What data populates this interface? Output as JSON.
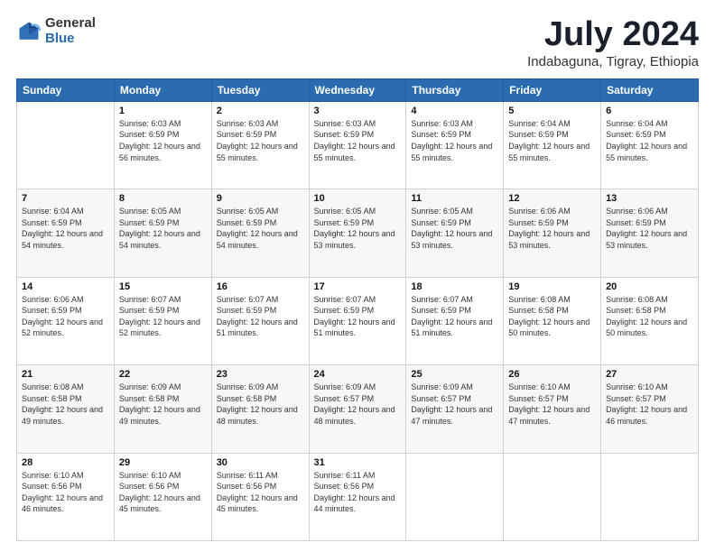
{
  "header": {
    "logo_general": "General",
    "logo_blue": "Blue",
    "month_title": "July 2024",
    "subtitle": "Indabaguna, Tigray, Ethiopia"
  },
  "weekdays": [
    "Sunday",
    "Monday",
    "Tuesday",
    "Wednesday",
    "Thursday",
    "Friday",
    "Saturday"
  ],
  "weeks": [
    [
      {
        "day": "",
        "sunrise": "",
        "sunset": "",
        "daylight": ""
      },
      {
        "day": "1",
        "sunrise": "Sunrise: 6:03 AM",
        "sunset": "Sunset: 6:59 PM",
        "daylight": "Daylight: 12 hours and 56 minutes."
      },
      {
        "day": "2",
        "sunrise": "Sunrise: 6:03 AM",
        "sunset": "Sunset: 6:59 PM",
        "daylight": "Daylight: 12 hours and 55 minutes."
      },
      {
        "day": "3",
        "sunrise": "Sunrise: 6:03 AM",
        "sunset": "Sunset: 6:59 PM",
        "daylight": "Daylight: 12 hours and 55 minutes."
      },
      {
        "day": "4",
        "sunrise": "Sunrise: 6:03 AM",
        "sunset": "Sunset: 6:59 PM",
        "daylight": "Daylight: 12 hours and 55 minutes."
      },
      {
        "day": "5",
        "sunrise": "Sunrise: 6:04 AM",
        "sunset": "Sunset: 6:59 PM",
        "daylight": "Daylight: 12 hours and 55 minutes."
      },
      {
        "day": "6",
        "sunrise": "Sunrise: 6:04 AM",
        "sunset": "Sunset: 6:59 PM",
        "daylight": "Daylight: 12 hours and 55 minutes."
      }
    ],
    [
      {
        "day": "7",
        "sunrise": "Sunrise: 6:04 AM",
        "sunset": "Sunset: 6:59 PM",
        "daylight": "Daylight: 12 hours and 54 minutes."
      },
      {
        "day": "8",
        "sunrise": "Sunrise: 6:05 AM",
        "sunset": "Sunset: 6:59 PM",
        "daylight": "Daylight: 12 hours and 54 minutes."
      },
      {
        "day": "9",
        "sunrise": "Sunrise: 6:05 AM",
        "sunset": "Sunset: 6:59 PM",
        "daylight": "Daylight: 12 hours and 54 minutes."
      },
      {
        "day": "10",
        "sunrise": "Sunrise: 6:05 AM",
        "sunset": "Sunset: 6:59 PM",
        "daylight": "Daylight: 12 hours and 53 minutes."
      },
      {
        "day": "11",
        "sunrise": "Sunrise: 6:05 AM",
        "sunset": "Sunset: 6:59 PM",
        "daylight": "Daylight: 12 hours and 53 minutes."
      },
      {
        "day": "12",
        "sunrise": "Sunrise: 6:06 AM",
        "sunset": "Sunset: 6:59 PM",
        "daylight": "Daylight: 12 hours and 53 minutes."
      },
      {
        "day": "13",
        "sunrise": "Sunrise: 6:06 AM",
        "sunset": "Sunset: 6:59 PM",
        "daylight": "Daylight: 12 hours and 53 minutes."
      }
    ],
    [
      {
        "day": "14",
        "sunrise": "Sunrise: 6:06 AM",
        "sunset": "Sunset: 6:59 PM",
        "daylight": "Daylight: 12 hours and 52 minutes."
      },
      {
        "day": "15",
        "sunrise": "Sunrise: 6:07 AM",
        "sunset": "Sunset: 6:59 PM",
        "daylight": "Daylight: 12 hours and 52 minutes."
      },
      {
        "day": "16",
        "sunrise": "Sunrise: 6:07 AM",
        "sunset": "Sunset: 6:59 PM",
        "daylight": "Daylight: 12 hours and 51 minutes."
      },
      {
        "day": "17",
        "sunrise": "Sunrise: 6:07 AM",
        "sunset": "Sunset: 6:59 PM",
        "daylight": "Daylight: 12 hours and 51 minutes."
      },
      {
        "day": "18",
        "sunrise": "Sunrise: 6:07 AM",
        "sunset": "Sunset: 6:59 PM",
        "daylight": "Daylight: 12 hours and 51 minutes."
      },
      {
        "day": "19",
        "sunrise": "Sunrise: 6:08 AM",
        "sunset": "Sunset: 6:58 PM",
        "daylight": "Daylight: 12 hours and 50 minutes."
      },
      {
        "day": "20",
        "sunrise": "Sunrise: 6:08 AM",
        "sunset": "Sunset: 6:58 PM",
        "daylight": "Daylight: 12 hours and 50 minutes."
      }
    ],
    [
      {
        "day": "21",
        "sunrise": "Sunrise: 6:08 AM",
        "sunset": "Sunset: 6:58 PM",
        "daylight": "Daylight: 12 hours and 49 minutes."
      },
      {
        "day": "22",
        "sunrise": "Sunrise: 6:09 AM",
        "sunset": "Sunset: 6:58 PM",
        "daylight": "Daylight: 12 hours and 49 minutes."
      },
      {
        "day": "23",
        "sunrise": "Sunrise: 6:09 AM",
        "sunset": "Sunset: 6:58 PM",
        "daylight": "Daylight: 12 hours and 48 minutes."
      },
      {
        "day": "24",
        "sunrise": "Sunrise: 6:09 AM",
        "sunset": "Sunset: 6:57 PM",
        "daylight": "Daylight: 12 hours and 48 minutes."
      },
      {
        "day": "25",
        "sunrise": "Sunrise: 6:09 AM",
        "sunset": "Sunset: 6:57 PM",
        "daylight": "Daylight: 12 hours and 47 minutes."
      },
      {
        "day": "26",
        "sunrise": "Sunrise: 6:10 AM",
        "sunset": "Sunset: 6:57 PM",
        "daylight": "Daylight: 12 hours and 47 minutes."
      },
      {
        "day": "27",
        "sunrise": "Sunrise: 6:10 AM",
        "sunset": "Sunset: 6:57 PM",
        "daylight": "Daylight: 12 hours and 46 minutes."
      }
    ],
    [
      {
        "day": "28",
        "sunrise": "Sunrise: 6:10 AM",
        "sunset": "Sunset: 6:56 PM",
        "daylight": "Daylight: 12 hours and 46 minutes."
      },
      {
        "day": "29",
        "sunrise": "Sunrise: 6:10 AM",
        "sunset": "Sunset: 6:56 PM",
        "daylight": "Daylight: 12 hours and 45 minutes."
      },
      {
        "day": "30",
        "sunrise": "Sunrise: 6:11 AM",
        "sunset": "Sunset: 6:56 PM",
        "daylight": "Daylight: 12 hours and 45 minutes."
      },
      {
        "day": "31",
        "sunrise": "Sunrise: 6:11 AM",
        "sunset": "Sunset: 6:56 PM",
        "daylight": "Daylight: 12 hours and 44 minutes."
      },
      {
        "day": "",
        "sunrise": "",
        "sunset": "",
        "daylight": ""
      },
      {
        "day": "",
        "sunrise": "",
        "sunset": "",
        "daylight": ""
      },
      {
        "day": "",
        "sunrise": "",
        "sunset": "",
        "daylight": ""
      }
    ]
  ]
}
